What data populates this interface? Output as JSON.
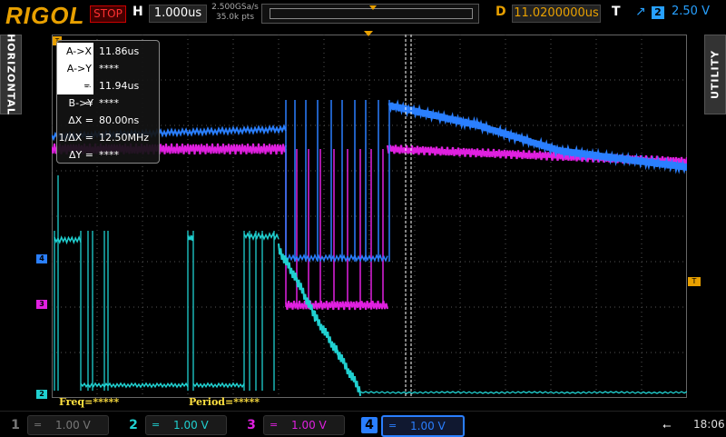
{
  "brand": {
    "logo": "RIGOL",
    "colors": {
      "brand": "#e8a000",
      "ch2": "#20d0d0",
      "ch3": "#e020e0",
      "ch4": "#2a7fff",
      "measure": "#ffe040"
    }
  },
  "top": {
    "run_status": "STOP",
    "h_label": "H",
    "timebase": "1.000us",
    "sample_rate": "2.500GSa/s",
    "memory_depth": "35.0k pts",
    "d_label": "D",
    "delay": "11.0200000us",
    "t_label": "T",
    "trigger_edge_icon": "rising-edge-icon",
    "trigger_edge_glyph": "↗",
    "trigger_source": "2",
    "trigger_level": "2.50 V"
  },
  "side": {
    "left_tab": "HORIZONTAL",
    "right_tab": "UTILITY"
  },
  "cursor": {
    "rows": [
      {
        "key": "A->X =",
        "value": "11.86us",
        "highlight": true
      },
      {
        "key": "A->Y =",
        "value": "****",
        "highlight": true
      },
      {
        "key": "B->X =",
        "value": "11.94us",
        "highlight": false
      },
      {
        "key": "B->Y =",
        "value": "****",
        "highlight": false
      },
      {
        "key": "ΔX =",
        "value": "80.00ns",
        "highlight": false
      },
      {
        "key": "1/ΔX =",
        "value": "12.50MHz",
        "highlight": false
      },
      {
        "key": "ΔY =",
        "value": "****",
        "highlight": false
      }
    ]
  },
  "markers": {
    "ch4": "4",
    "ch3": "3",
    "ch2": "2",
    "trigger_level": "T",
    "cursor_a": "T"
  },
  "measurements": {
    "freq": "Freq=*****",
    "period": "Period=*****"
  },
  "channels": [
    {
      "num": "1",
      "coupling_icon": "dc-coupling-icon",
      "coupling": "=",
      "scale": "1.00 V",
      "active": false
    },
    {
      "num": "2",
      "coupling_icon": "dc-coupling-icon",
      "coupling": "=",
      "scale": "1.00 V",
      "active": true
    },
    {
      "num": "3",
      "coupling_icon": "dc-coupling-icon",
      "coupling": "=",
      "scale": "1.00 V",
      "active": true
    },
    {
      "num": "4",
      "coupling_icon": "dc-coupling-icon",
      "coupling": "=",
      "scale": "1.00 V",
      "active": true
    }
  ],
  "status": {
    "usb_icon": "usb-icon",
    "usb_glyph": "⭠",
    "clock": "18:06"
  }
}
